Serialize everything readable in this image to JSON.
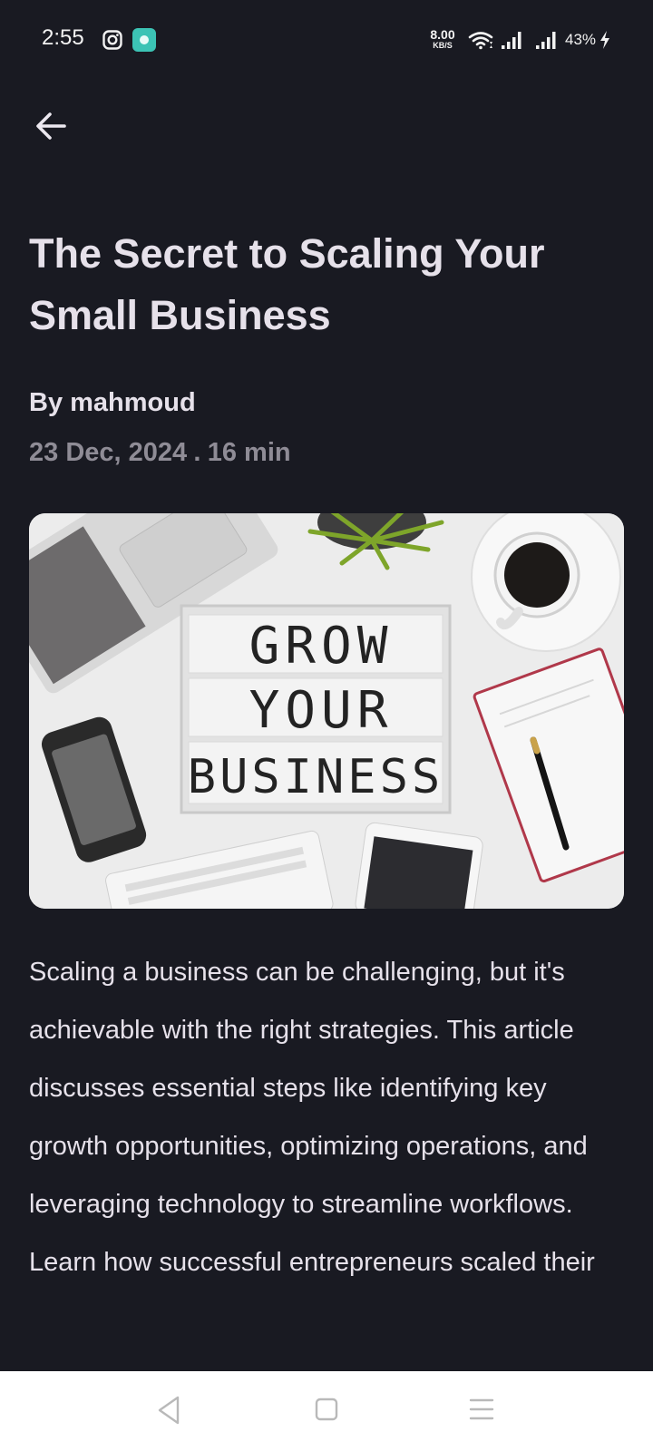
{
  "status_bar": {
    "time": "2:55",
    "net_speed_value": "8.00",
    "net_speed_unit": "KB/S",
    "battery": "43%",
    "icons": [
      "instagram-icon",
      "app-notification-icon",
      "wifi-icon",
      "signal-icon",
      "signal-icon",
      "charging-icon"
    ]
  },
  "header": {
    "back_icon": "arrow-left-icon"
  },
  "article": {
    "title": "The Secret to Scaling Your Small Business",
    "author": "By mahmoud",
    "date": "23 Dec, 2024",
    "separator": ".",
    "read_time": "16 min",
    "image_sign_lines": [
      "GROW",
      "YOUR",
      "BUSINESS"
    ],
    "body": "Scaling a business can be challenging, but it's achievable with the right strategies. This article discusses essential steps like identifying key growth opportunities, optimizing operations, and leveraging technology to streamline workflows. Learn how successful entrepreneurs scaled their"
  },
  "nav_bar": {
    "icons": [
      "back-triangle-icon",
      "home-square-icon",
      "menu-lines-icon"
    ]
  },
  "colors": {
    "background": "#191a22",
    "text": "#e6e1ea",
    "muted": "#8f8c96",
    "nav": "#ffffff"
  }
}
